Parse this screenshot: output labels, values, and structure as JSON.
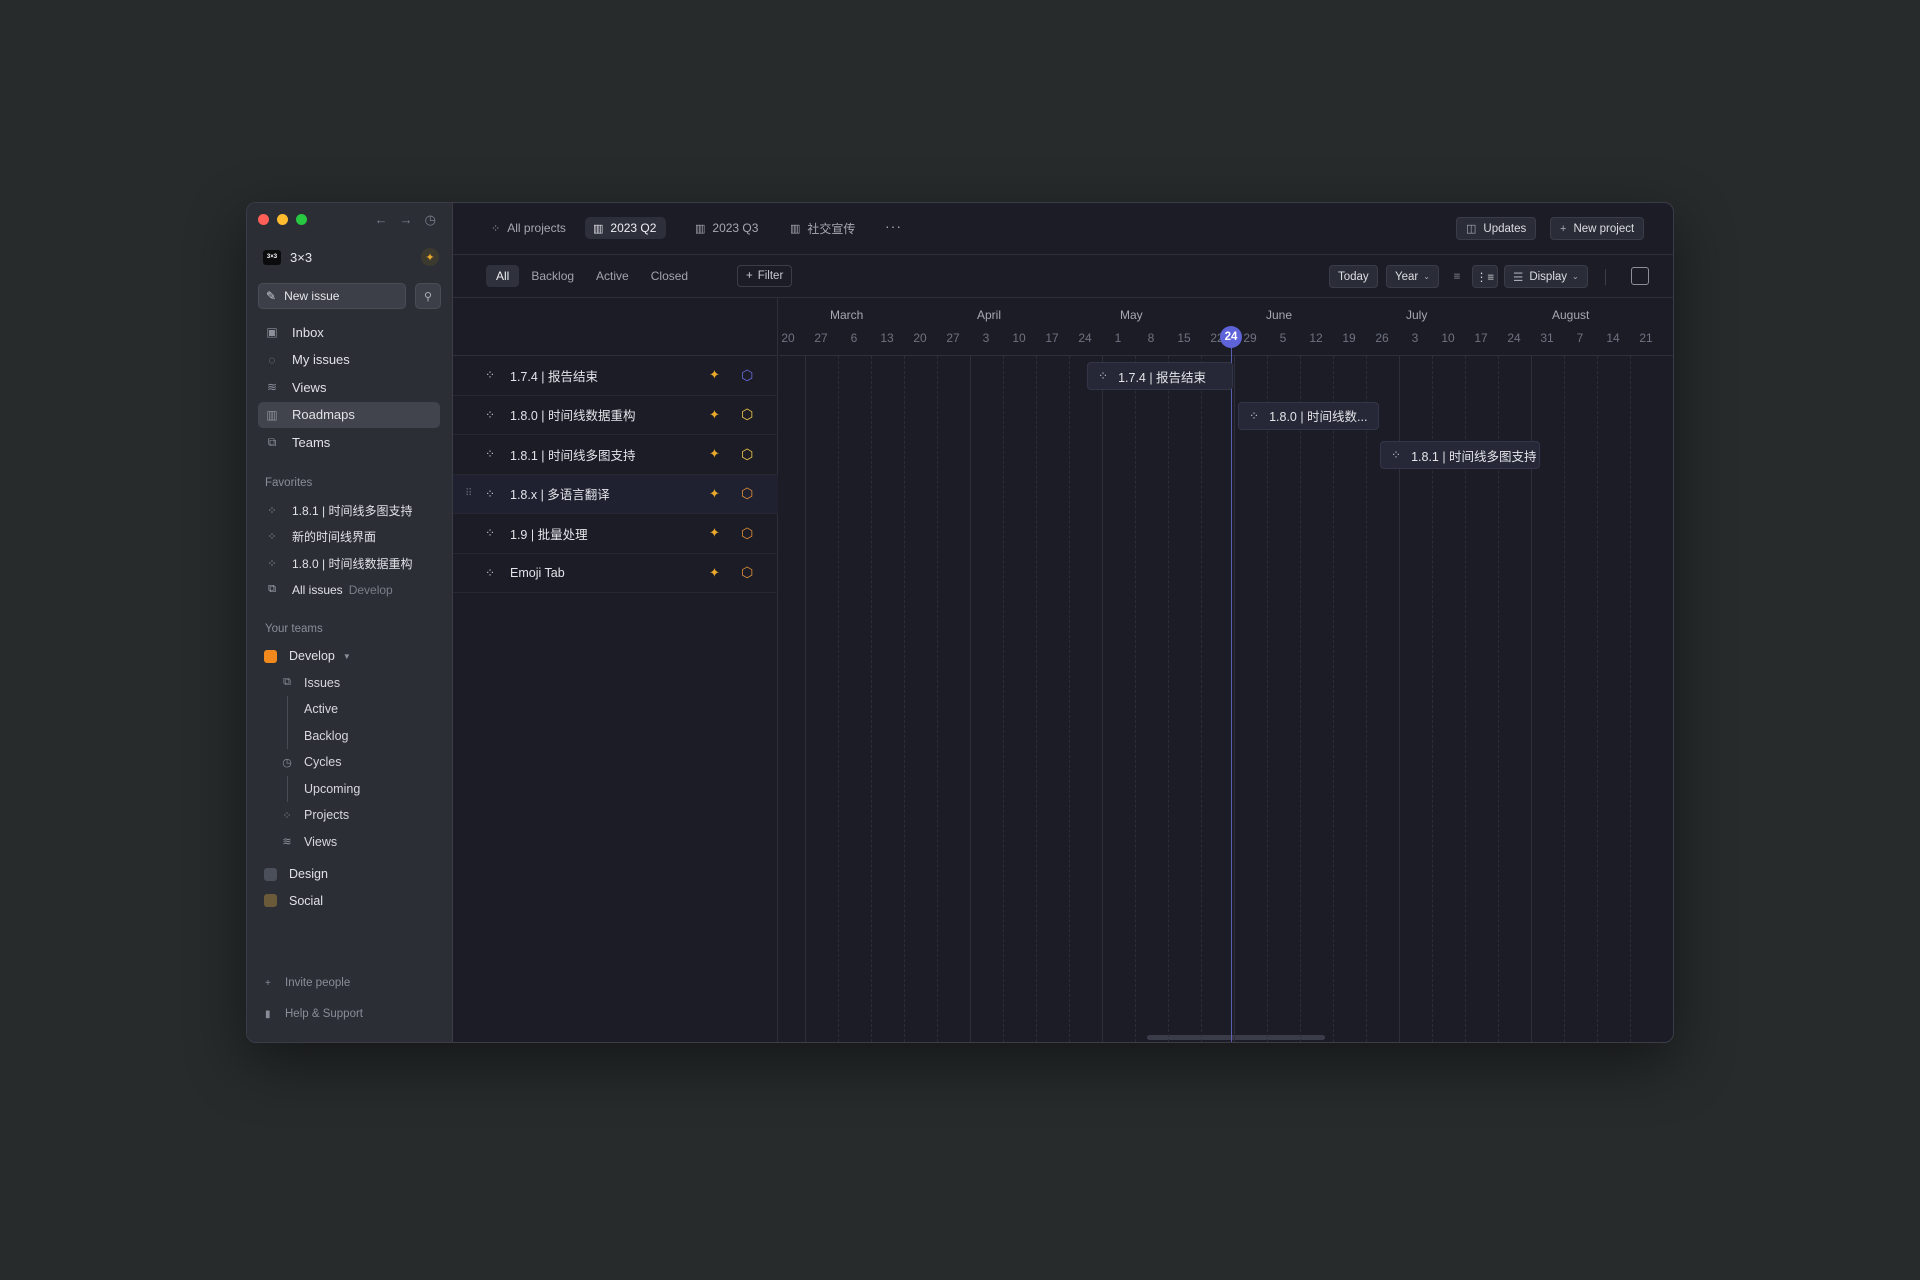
{
  "workspace": {
    "name": "3×3",
    "logo_text": "3×3"
  },
  "sidebar": {
    "new_issue": "New issue",
    "nav": [
      {
        "label": "Inbox",
        "icon": "inbox-icon"
      },
      {
        "label": "My issues",
        "icon": "my-issues-icon"
      },
      {
        "label": "Views",
        "icon": "layers-icon"
      },
      {
        "label": "Roadmaps",
        "icon": "map-icon",
        "active": true
      },
      {
        "label": "Teams",
        "icon": "teams-icon"
      }
    ],
    "favorites_title": "Favorites",
    "favorites": [
      {
        "label": "1.8.1 | 时间线多图支持"
      },
      {
        "label": "新的时间线界面"
      },
      {
        "label": "1.8.0 | 时间线数据重构"
      },
      {
        "label": "All issues",
        "muted": "Develop"
      }
    ],
    "teams_title": "Your teams",
    "team_develop": "Develop",
    "develop_items": {
      "issues": "Issues",
      "active": "Active",
      "backlog": "Backlog",
      "cycles": "Cycles",
      "upcoming": "Upcoming",
      "projects": "Projects",
      "views": "Views"
    },
    "team_design": "Design",
    "team_social": "Social",
    "invite": "Invite people",
    "help": "Help & Support"
  },
  "topbar": {
    "tabs": [
      {
        "label": "All projects",
        "icon": "grid-icon"
      },
      {
        "label": "2023 Q2",
        "icon": "map-icon",
        "active": true
      },
      {
        "label": "2023 Q3",
        "icon": "map-icon"
      },
      {
        "label": "社交宣传",
        "icon": "map-icon"
      }
    ],
    "more": "···",
    "updates": "Updates",
    "new_project": "New project"
  },
  "filterbar": {
    "segments": [
      "All",
      "Backlog",
      "Active",
      "Closed"
    ],
    "filter": "Filter",
    "today": "Today",
    "zoom": "Year",
    "display": "Display"
  },
  "projects": [
    {
      "name": "1.7.4 | 报告结束",
      "status": "completed",
      "status_color": "#6a6fe0"
    },
    {
      "name": "1.8.0 | 时间线数据重构",
      "status": "in-progress",
      "status_color": "#f2c94c"
    },
    {
      "name": "1.8.1 | 时间线多图支持",
      "status": "in-progress",
      "status_color": "#f2c94c"
    },
    {
      "name": "1.8.x | 多语言翻译",
      "status": "planned",
      "status_color": "#e0913a"
    },
    {
      "name": "1.9 | 批量处理",
      "status": "planned",
      "status_color": "#e0913a"
    },
    {
      "name": "Emoji Tab",
      "status": "planned",
      "status_color": "#e0913a"
    }
  ],
  "timeline": {
    "months": [
      "March",
      "April",
      "May",
      "June",
      "July",
      "August"
    ],
    "weeks": [
      "20",
      "27",
      "6",
      "13",
      "20",
      "27",
      "3",
      "10",
      "17",
      "24",
      "1",
      "8",
      "15",
      "22",
      "29",
      "5",
      "12",
      "19",
      "26",
      "3",
      "10",
      "17",
      "24",
      "31",
      "7",
      "14",
      "21"
    ],
    "today": "24",
    "bars": [
      {
        "label": "1.7.4 | 报告结束"
      },
      {
        "label": "1.8.0 | 时间线数..."
      },
      {
        "label": "1.8.1 | 时间线多图支持"
      }
    ]
  },
  "colors": {
    "accent": "#5e63d8",
    "lead_avatar": "#e9a92b",
    "team_develop": "#f2891d",
    "team_design": "#4a4f5a",
    "team_social": "#6a5a3a"
  }
}
